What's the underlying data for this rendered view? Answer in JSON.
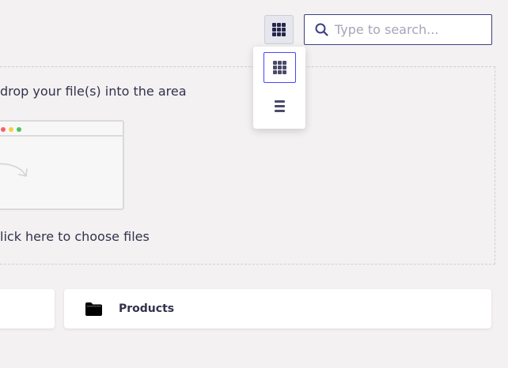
{
  "toolbar": {
    "view_toggle_icon": "grid-icon",
    "search": {
      "value": "",
      "placeholder": "Type to search...",
      "icon": "search-icon"
    }
  },
  "view_menu": {
    "options": [
      {
        "icon": "grid-icon",
        "selected": true
      },
      {
        "icon": "list-icon",
        "selected": false
      }
    ]
  },
  "dropzone": {
    "drag_text": "drop your file(s) into the area",
    "click_text": "lick here to choose files",
    "illustration": "browser-window-illustration"
  },
  "folders": [
    {
      "label": "",
      "icon": "folder-icon"
    },
    {
      "label": "Products",
      "icon": "folder-icon"
    }
  ],
  "colors": {
    "accent": "#4945ff",
    "search_border": "#3d3f82",
    "text": "#32324d",
    "background": "#f3f1f1"
  }
}
